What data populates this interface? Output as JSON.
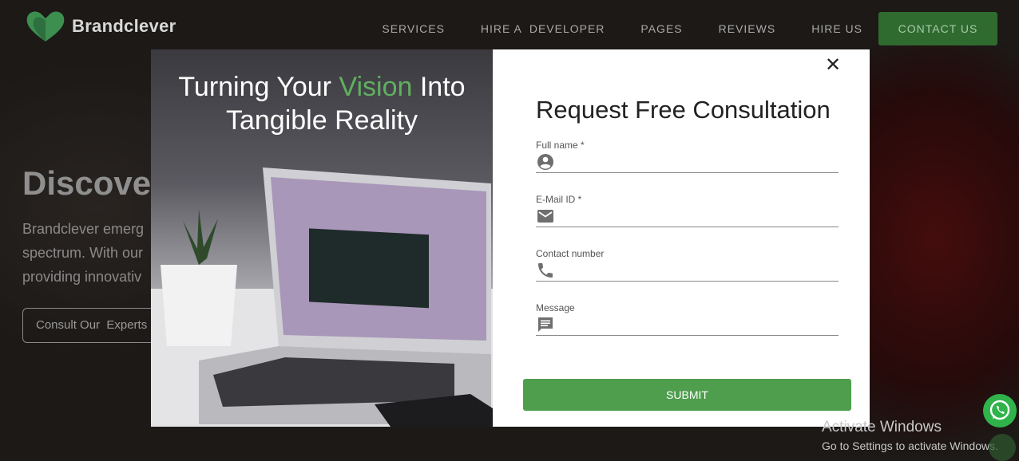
{
  "brand": {
    "name": "Brandclever",
    "logo_color": "#3c8f4f"
  },
  "nav": {
    "items": [
      "SERVICES",
      "HIRE A  DEVELOPER",
      "PAGES",
      "REVIEWS",
      "HIRE US"
    ],
    "cta": "CONTACT US"
  },
  "hero": {
    "title": "Discover",
    "lines": [
      "Brandclever emerg",
      "spectrum. With our",
      "providing innovativ"
    ],
    "button": "Consult Our  Experts"
  },
  "modal": {
    "headline_part1": "Turning Your ",
    "headline_highlight": "Vision",
    "headline_part2": " Into",
    "headline_line2": "Tangible Reality",
    "form_title": "Request Free Consultation",
    "fields": [
      {
        "label": "Full name *",
        "icon": "person-icon",
        "value": ""
      },
      {
        "label": "E-Mail ID *",
        "icon": "mail-icon",
        "value": ""
      },
      {
        "label": "Contact number",
        "icon": "phone-icon",
        "value": ""
      },
      {
        "label": "Message",
        "icon": "message-icon",
        "value": ""
      }
    ],
    "submit": "SUBMIT",
    "close_icon": "close-icon"
  },
  "windows": {
    "line1": "Activate Windows",
    "line2": "Go to Settings to activate Windows."
  },
  "colors": {
    "accent": "#4e9e4e",
    "highlight": "#5fb05f",
    "nav_cta_bg": "#2f6b2f"
  }
}
